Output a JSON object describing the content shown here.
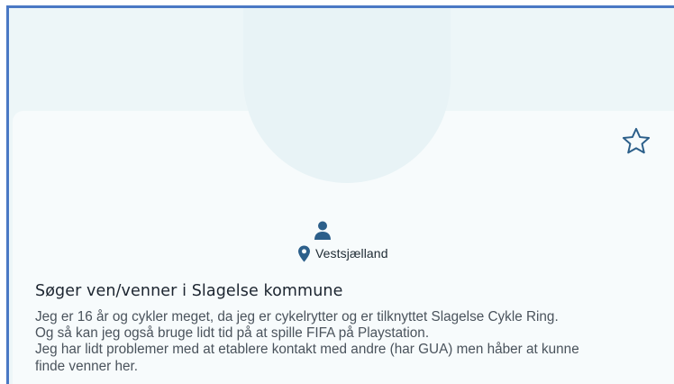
{
  "profile": {
    "location": "Vestsjælland",
    "title": "Søger ven/venner i Slagelse kommune",
    "description_lines": [
      "Jeg er 16 år og cykler meget, da jeg er cykelrytter og er tilknyttet Slagelse Cykle Ring.",
      "Og så kan jeg også bruge lidt tid på at spille FIFA på Playstation.",
      "Jeg har lidt problemer med at etablere kontakt med andre (har GUA) men håber at kunne",
      "finde venner her."
    ]
  },
  "icons": {
    "favorite": "star-outline-icon",
    "person": "person-icon",
    "location": "map-pin-icon"
  },
  "colors": {
    "frame_border": "#4a78c4",
    "background": "#edf6f8",
    "card": "#f7fbfc",
    "icon": "#2c5f8a"
  }
}
